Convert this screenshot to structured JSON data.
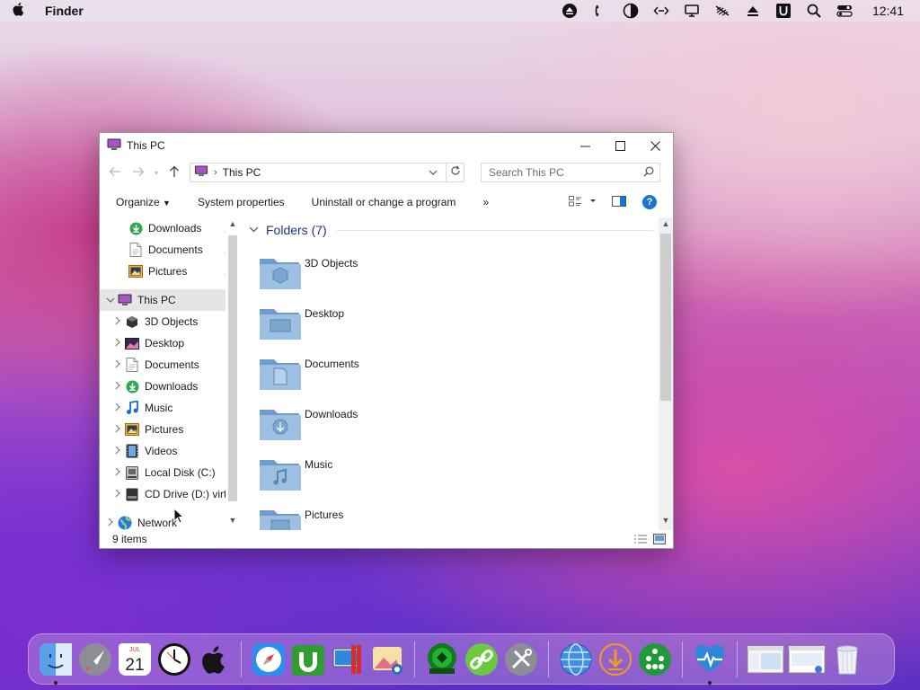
{
  "menubar": {
    "app_name": "Finder",
    "clock": "12:41",
    "status_icons": [
      "eject-icon",
      "pause-icon",
      "contrast-icon",
      "code-icon",
      "display-icon",
      "mute-icon",
      "upload-icon",
      "u-app-icon",
      "search-icon",
      "control-center-icon"
    ]
  },
  "window": {
    "title": "This PC",
    "address": {
      "location": "This PC"
    },
    "search_placeholder": "Search This PC",
    "toolbar": {
      "organize": "Organize",
      "system_properties": "System properties",
      "uninstall": "Uninstall or change a program",
      "more": "»"
    },
    "nav": {
      "quick_access": [
        {
          "label": "Downloads",
          "icon": "downloads-icon"
        },
        {
          "label": "Documents",
          "icon": "documents-icon"
        },
        {
          "label": "Pictures",
          "icon": "pictures-icon"
        }
      ],
      "this_pc": {
        "label": "This PC"
      },
      "this_pc_children": [
        {
          "label": "3D Objects",
          "icon": "3d-objects-icon"
        },
        {
          "label": "Desktop",
          "icon": "desktop-icon"
        },
        {
          "label": "Documents",
          "icon": "documents-icon"
        },
        {
          "label": "Downloads",
          "icon": "downloads-icon"
        },
        {
          "label": "Music",
          "icon": "music-icon"
        },
        {
          "label": "Pictures",
          "icon": "pictures-icon"
        },
        {
          "label": "Videos",
          "icon": "videos-icon"
        },
        {
          "label": "Local Disk (C:)",
          "icon": "local-disk-icon"
        },
        {
          "label": "CD Drive (D:) virt",
          "icon": "cd-drive-icon"
        }
      ],
      "network": {
        "label": "Network"
      }
    },
    "content": {
      "group_label": "Folders (7)",
      "folders": [
        {
          "name": "3D Objects"
        },
        {
          "name": "Desktop"
        },
        {
          "name": "Documents"
        },
        {
          "name": "Downloads"
        },
        {
          "name": "Music"
        },
        {
          "name": "Pictures"
        }
      ]
    },
    "status": {
      "item_count": "9 items"
    }
  },
  "dock": {
    "apps": [
      "finder-icon",
      "launchpad-icon",
      "calendar-icon",
      "clock-icon",
      "apple-logo-icon",
      "safari-icon",
      "utorrent-icon",
      "parallels-icon",
      "photo-viewer-icon",
      "collabs-icon",
      "link-icon",
      "tools-icon",
      "globe-icon",
      "download-icon",
      "network-people-icon",
      "health-monitor-icon",
      "window-1-icon",
      "window-2-icon",
      "trash-icon"
    ],
    "calendar": {
      "month": "JUL",
      "day": "21"
    }
  },
  "colors": {
    "accent": "#1a75d0",
    "group_header": "#1e3287",
    "folder_blue": "#8fb4d6"
  }
}
